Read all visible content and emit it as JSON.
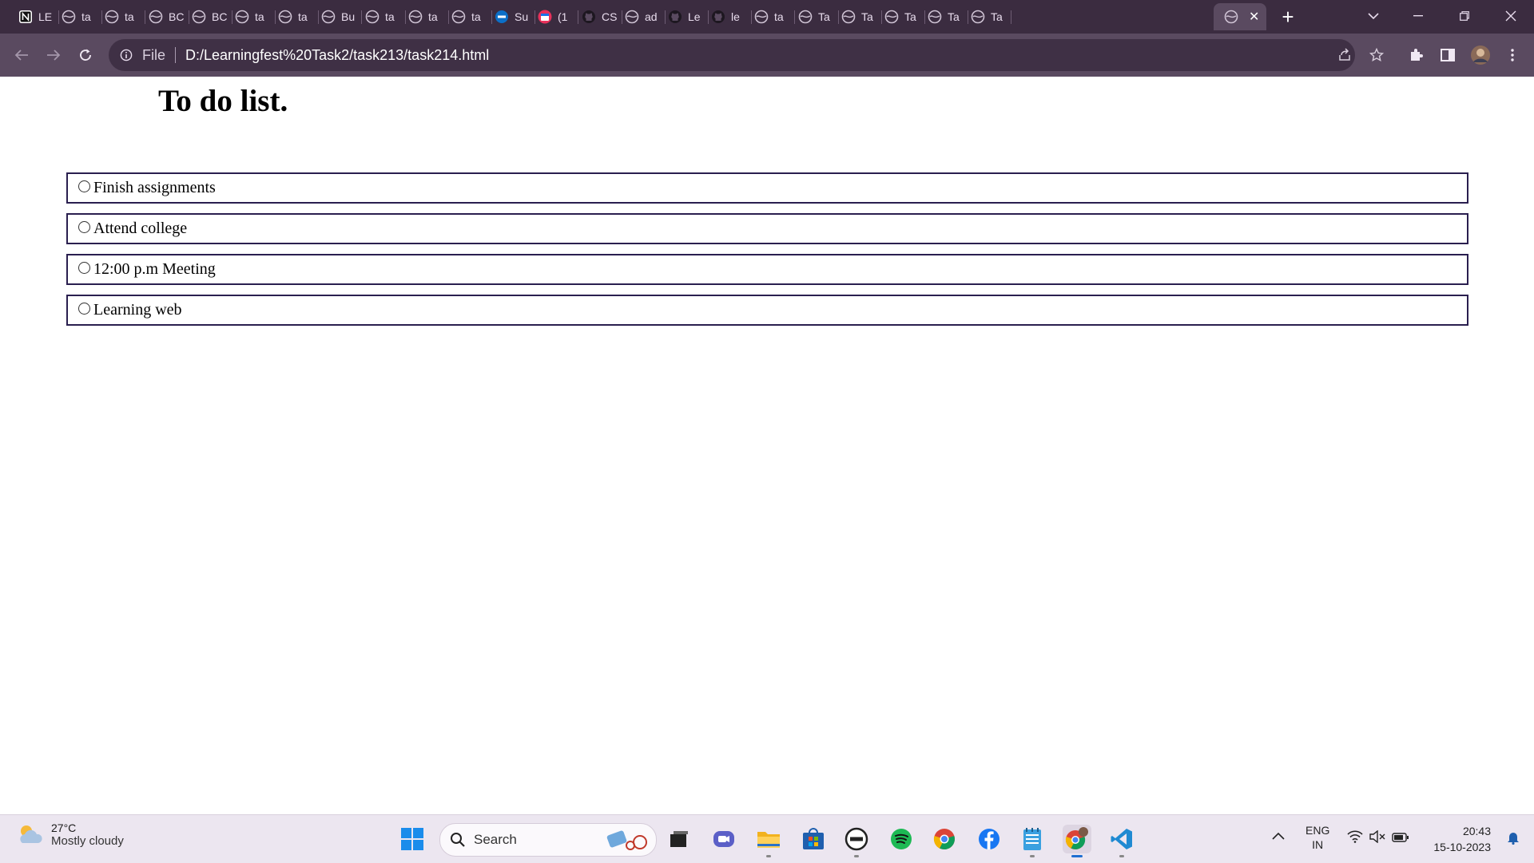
{
  "browser": {
    "tabs": [
      {
        "title": "LE",
        "icon": "notion-icon"
      },
      {
        "title": "ta",
        "icon": "globe-icon"
      },
      {
        "title": "ta",
        "icon": "globe-icon"
      },
      {
        "title": "BC",
        "icon": "globe-icon"
      },
      {
        "title": "BC",
        "icon": "globe-icon"
      },
      {
        "title": "ta",
        "icon": "globe-icon"
      },
      {
        "title": "ta",
        "icon": "globe-icon"
      },
      {
        "title": "Bu",
        "icon": "globe-icon"
      },
      {
        "title": "ta",
        "icon": "globe-icon"
      },
      {
        "title": "ta",
        "icon": "globe-icon"
      },
      {
        "title": "ta",
        "icon": "globe-icon"
      },
      {
        "title": "Su",
        "icon": "dell-icon"
      },
      {
        "title": "(1",
        "icon": "calendar-icon"
      },
      {
        "title": "CS",
        "icon": "github-icon"
      },
      {
        "title": "ad",
        "icon": "globe-icon"
      },
      {
        "title": "Le",
        "icon": "github-icon"
      },
      {
        "title": "le",
        "icon": "github-icon"
      },
      {
        "title": "ta",
        "icon": "globe-icon"
      },
      {
        "title": "Ta",
        "icon": "globe-icon"
      },
      {
        "title": "Ta",
        "icon": "globe-icon"
      },
      {
        "title": "Ta",
        "icon": "globe-icon"
      },
      {
        "title": "Ta",
        "icon": "globe-icon"
      },
      {
        "title": "Ta",
        "icon": "globe-icon"
      }
    ],
    "new_tab_label": "+",
    "address": {
      "scheme_label": "File",
      "url": "D:/Learningfest%20Task2/task213/task214.html"
    }
  },
  "page": {
    "title": "To do list.",
    "todos": [
      {
        "text": "Finish assignments",
        "checked": false
      },
      {
        "text": "Attend college",
        "checked": false
      },
      {
        "text": "12:00 p.m Meeting",
        "checked": false
      },
      {
        "text": "Learning web",
        "checked": false
      }
    ]
  },
  "taskbar": {
    "weather": {
      "temp": "27°C",
      "condition": "Mostly cloudy"
    },
    "search_placeholder": "Search",
    "language": {
      "line1": "ENG",
      "line2": "IN"
    },
    "clock": {
      "time": "20:43",
      "date": "15-10-2023"
    }
  },
  "colors": {
    "tabstrip": "#3b2c40",
    "toolbar": "#5a4a60",
    "todo_border": "#2a1f4f",
    "taskbar": "#ece6f0"
  }
}
